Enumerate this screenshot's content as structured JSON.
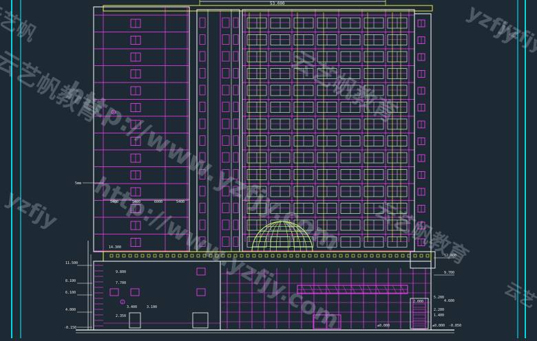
{
  "colors": {
    "background": "#1e2a33",
    "frame_line": "#00d8e8",
    "wall_line": "#ffffff",
    "window_line": "#ff3cff",
    "structure_line": "#ffff40",
    "dome_line": "#c8ff70",
    "dimension_text": "#e8e8e8"
  },
  "drawing": {
    "top_dimension": "53.000",
    "left_marker": "5mm",
    "bay_dims": [
      "5400",
      "5400",
      "6000",
      "5400"
    ],
    "podium_roof_level": "14.300",
    "left_levels": [
      "11.500",
      "8.100",
      "6.100",
      "4.000"
    ],
    "left_bottom_level": "-0.150",
    "left_mid_levels": [
      "9.800",
      "7.700",
      "3.400",
      "2.350"
    ],
    "left_level_label": "3.100",
    "right_top_level": "12.800",
    "right_mid_level": "9.700",
    "right_levels": [
      "5.200",
      "4.600",
      "2.200",
      "1.400"
    ],
    "right_small_level": "2.000",
    "right_bottom_level": "±0.000",
    "right_bottom_level_2": "-0.050",
    "center_bottom_level": "±0.000",
    "axis_marks": [
      "1",
      "2"
    ]
  },
  "watermarks": {
    "url": "http://www.yzfjy.com",
    "brand": "云艺帆教育",
    "brand_short": "yzfjy",
    "small_corner": "云艺帆",
    "right_edge": "yzfjy",
    "right_edge_2": "云艺"
  }
}
